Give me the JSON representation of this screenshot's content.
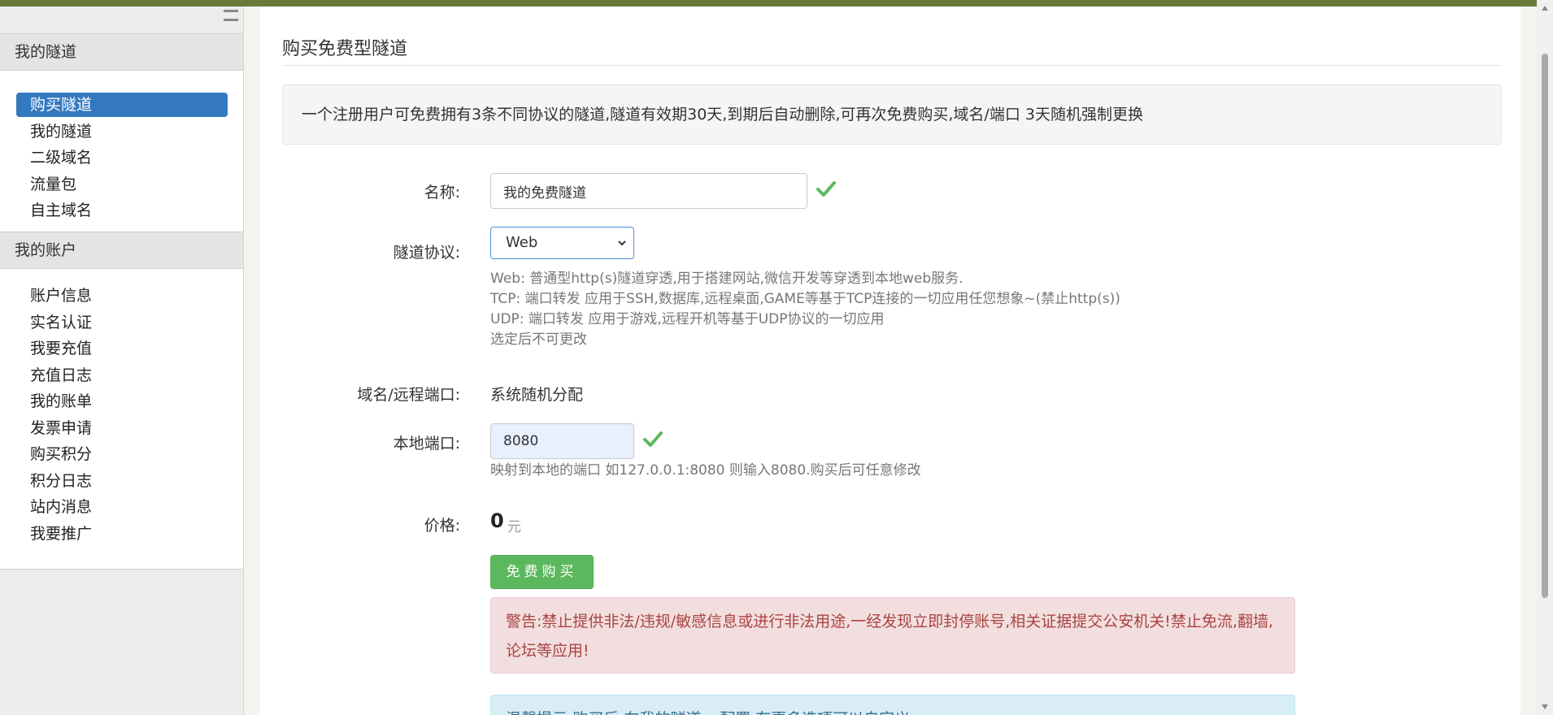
{
  "sidebar": {
    "section1_title": "我的隧道",
    "section1_items": [
      "购买隧道",
      "我的隧道",
      "二级域名",
      "流量包",
      "自主域名"
    ],
    "section2_title": "我的账户",
    "section2_items": [
      "账户信息",
      "实名认证",
      "我要充值",
      "充值日志",
      "我的账单",
      "发票申请",
      "购买积分",
      "积分日志",
      "站内消息",
      "我要推广"
    ]
  },
  "main": {
    "title": "购买免费型隧道",
    "notice": "一个注册用户可免费拥有3条不同协议的隧道,隧道有效期30天,到期后自动删除,可再次免费购买,域名/端口 3天随机强制更换",
    "form": {
      "name_label": "名称:",
      "name_value": "我的免费隧道",
      "protocol_label": "隧道协议:",
      "protocol_value": "Web",
      "protocol_help": [
        "Web: 普通型http(s)隧道穿透,用于搭建网站,微信开发等穿透到本地web服务.",
        "TCP: 端口转发 应用于SSH,数据库,远程桌面,GAME等基于TCP连接的一切应用任您想象~(禁止http(s))",
        "UDP: 端口转发 应用于游戏,远程开机等基于UDP协议的一切应用",
        "选定后不可更改"
      ],
      "domain_label": "域名/远程端口:",
      "domain_value": "系统随机分配",
      "port_label": "本地端口:",
      "port_value": "8080",
      "port_help": "映射到本地的端口 如127.0.0.1:8080 则输入8080.购买后可任意修改",
      "price_label": "价格:",
      "price_value": "0",
      "price_unit": "元",
      "buy_label": "免费购买"
    },
    "warning": "警告:禁止提供非法/违规/敏感信息或进行非法用途,一经发现立即封停账号,相关证据提交公安机关!禁止免流,翻墙,论坛等应用!",
    "tip": "温馨提示:购买后,在我的隧道->配置,有更多选项可以自定义"
  },
  "colors": {
    "topbar": "#6b7a38",
    "active_nav": "#3479c0",
    "buy_button": "#5cb85c",
    "check_icon": "#5cb85c",
    "danger_text": "#a94442",
    "danger_bg": "#f2dede",
    "info_bg": "#d9edf7"
  }
}
